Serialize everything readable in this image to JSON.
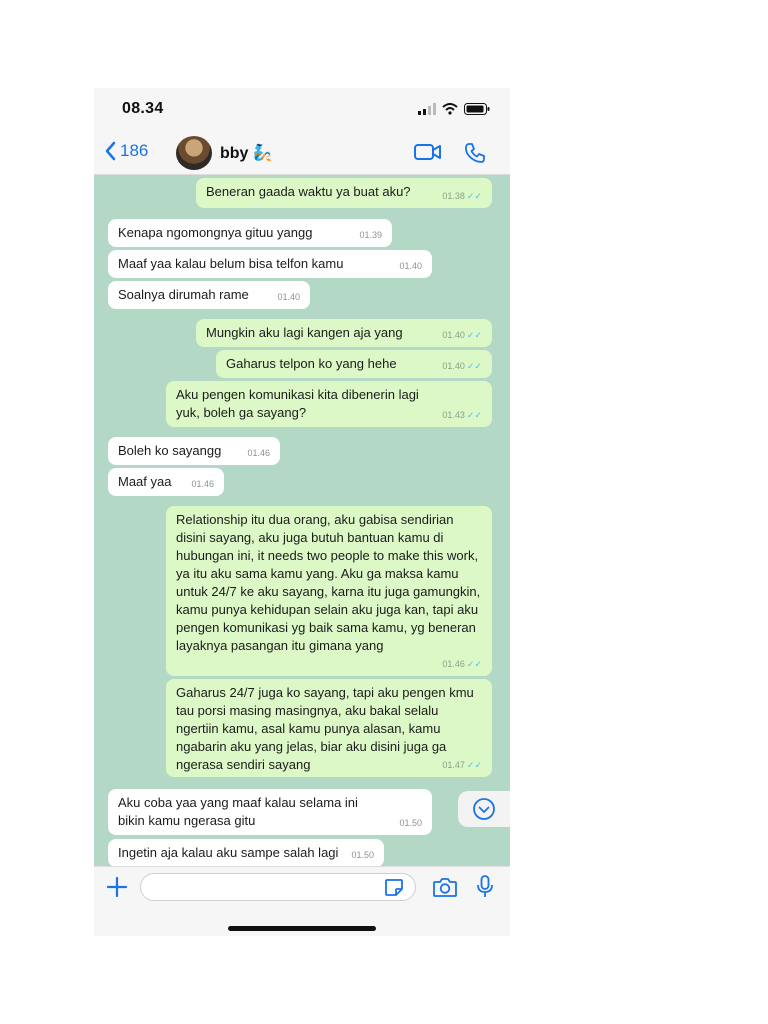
{
  "status": {
    "time": "08.34"
  },
  "header": {
    "back_count": "186",
    "contact_name": "bby 🧞"
  },
  "messages": [
    {
      "dir": "out",
      "text": "Beneran gaada waktu ya buat aku?",
      "time": "01.38"
    },
    {
      "dir": "in",
      "text": "Kenapa ngomongnya gituu yangg",
      "time": "01.39"
    },
    {
      "dir": "in",
      "text": "Maaf yaa kalau belum bisa telfon kamu",
      "time": "01.40"
    },
    {
      "dir": "in",
      "text": "Soalnya dirumah rame",
      "time": "01.40"
    },
    {
      "dir": "out",
      "text": "Mungkin aku lagi kangen aja yang",
      "time": "01.40"
    },
    {
      "dir": "out",
      "text": "Gaharus telpon ko yang hehe",
      "time": "01.40"
    },
    {
      "dir": "out",
      "text": "Aku pengen komunikasi kita dibenerin lagi yuk, boleh ga sayang?",
      "time": "01.43"
    },
    {
      "dir": "in",
      "text": "Boleh ko sayangg",
      "time": "01.46"
    },
    {
      "dir": "in",
      "text": "Maaf yaa",
      "time": "01.46"
    },
    {
      "dir": "out",
      "text": "Relationship itu dua orang, aku gabisa sendirian disini sayang, aku juga butuh bantuan kamu di hubungan ini, it needs two people to make this work, ya itu aku sama kamu yang. Aku ga maksa kamu untuk 24/7 ke aku sayang, karna itu juga gamungkin, kamu punya kehidupan selain aku juga kan, tapi aku pengen komunikasi yg baik sama kamu, yg beneran layaknya pasangan itu gimana yang",
      "time": "01.46"
    },
    {
      "dir": "out",
      "text": "Gaharus 24/7 juga ko sayang, tapi aku pengen kmu tau porsi masing masingnya, aku bakal selalu ngertiin kamu, asal kamu punya alasan, kamu ngabarin aku yang jelas, biar aku disini juga ga ngerasa sendiri sayang",
      "time": "01.47"
    },
    {
      "dir": "in",
      "text": "Aku coba yaa yang maaf kalau selama ini bikin kamu ngerasa gitu",
      "time": "01.50"
    },
    {
      "dir": "in",
      "text": "Ingetin aja kalau aku sampe salah lagi",
      "time": "01.50"
    }
  ],
  "composer": {
    "input_value": ""
  },
  "icons": [
    "chevron-left-icon",
    "video-icon",
    "phone-icon",
    "plus-icon",
    "sticker-icon",
    "camera-icon",
    "mic-icon",
    "chevron-down-icon",
    "signal-icon",
    "wifi-icon",
    "battery-icon",
    "read-ticks-icon"
  ],
  "colors": {
    "accent": "#1a73e8",
    "chat_bg": "#b3d9c6",
    "outgoing_bubble": "#dcf8c6",
    "incoming_bubble": "#ffffff",
    "read_tick": "#53bdeb"
  }
}
